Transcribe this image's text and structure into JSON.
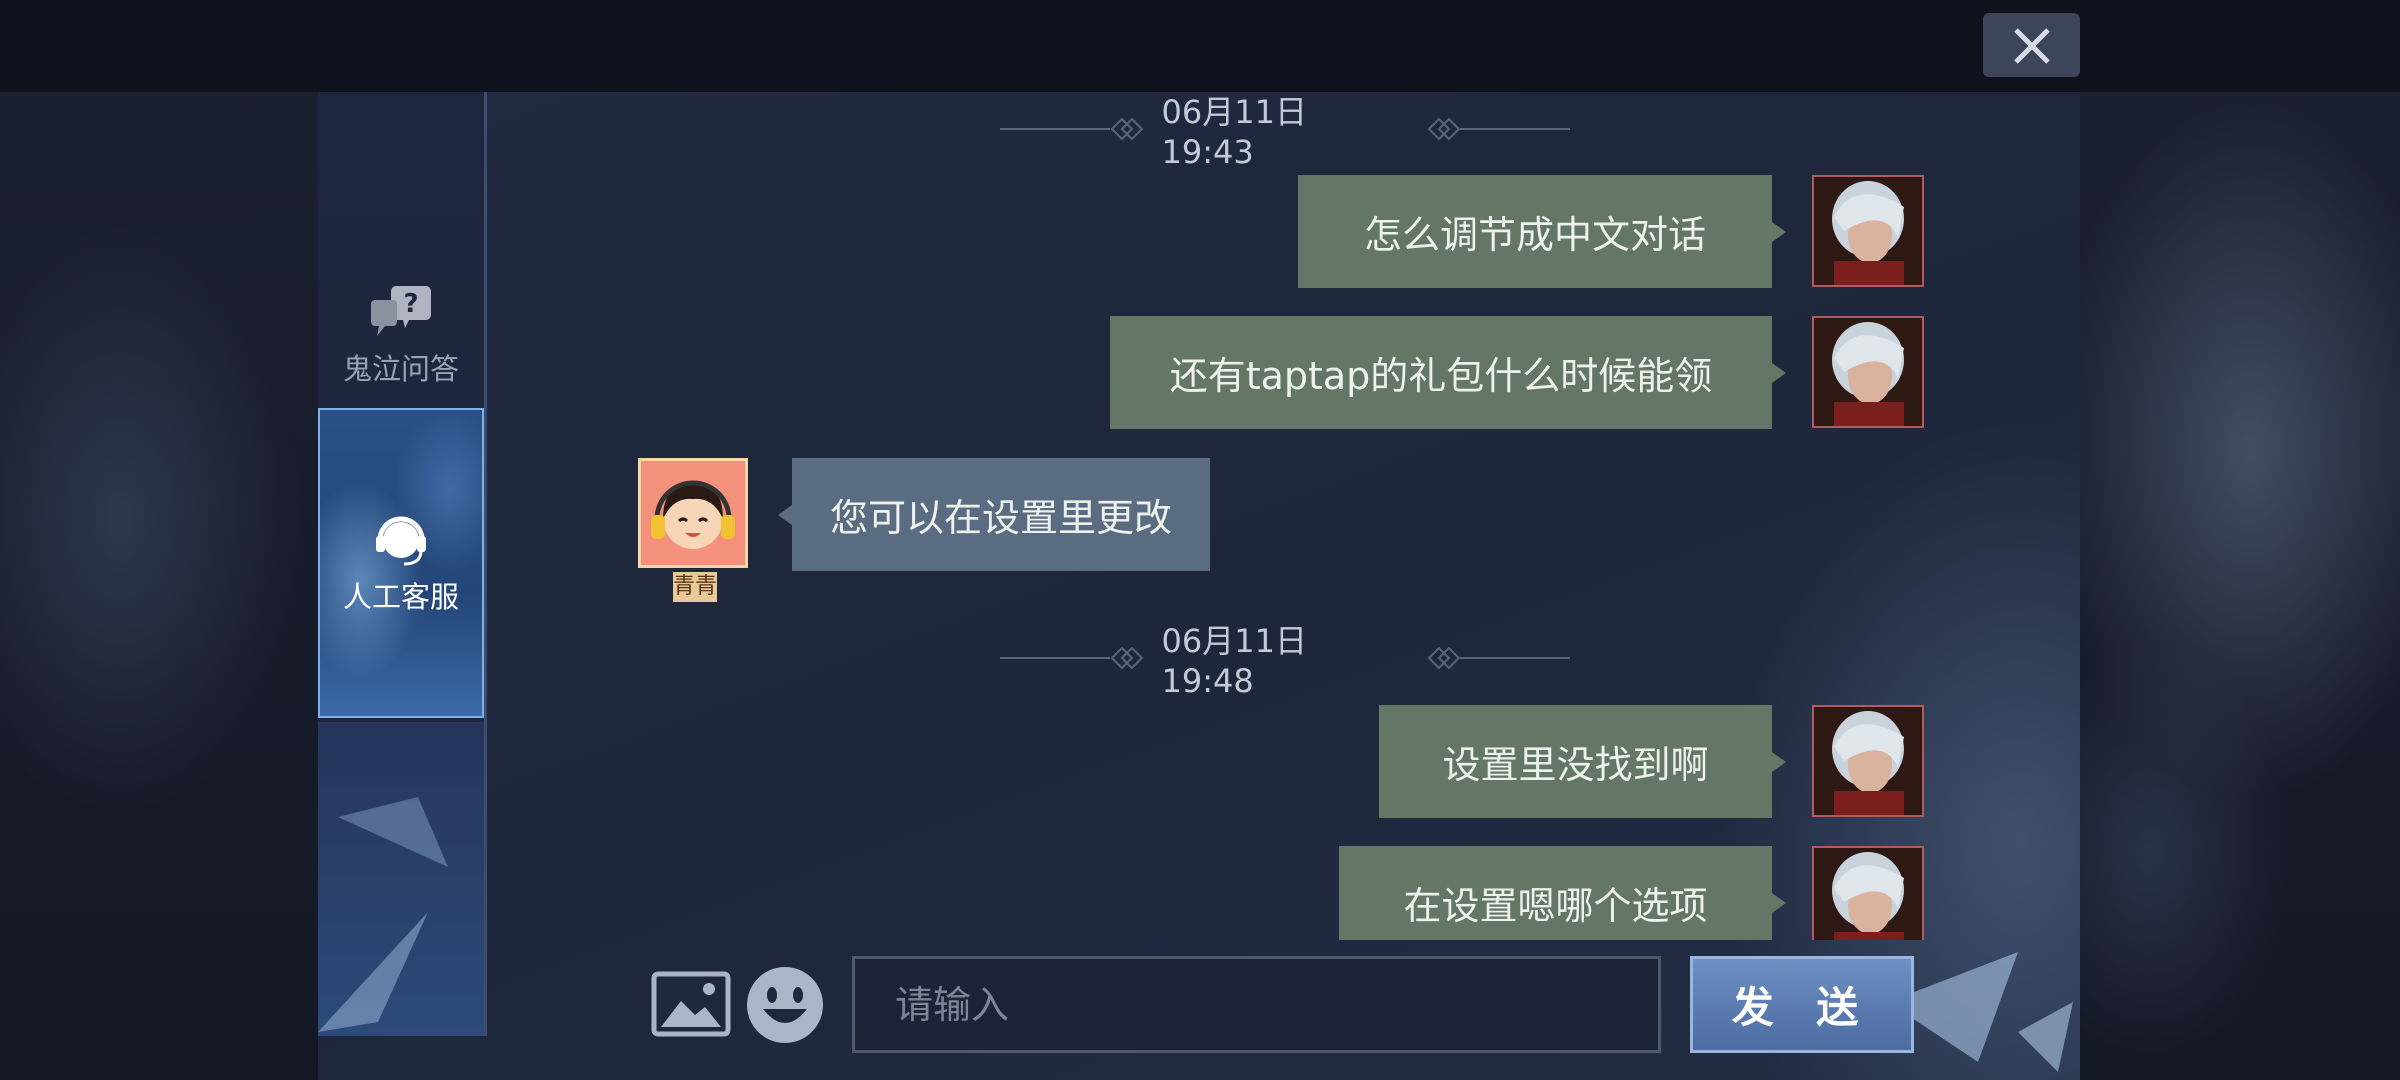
{
  "header": {
    "close_icon": "close-icon"
  },
  "nav": {
    "items": [
      {
        "label": "鬼泣问答",
        "icon": "question-chat-icon",
        "active": false
      },
      {
        "label": "人工客服",
        "icon": "headset-icon",
        "active": true
      }
    ]
  },
  "chat": {
    "timestamps": [
      "06月11日 19:43",
      "06月11日 19:48"
    ],
    "messages": [
      {
        "side": "out",
        "text": "怎么调节成中文对话"
      },
      {
        "side": "out",
        "text": "还有taptap的礼包什么时候能领"
      },
      {
        "side": "in",
        "text": "您可以在设置里更改",
        "sender": "青青"
      },
      {
        "side": "out",
        "text": "设置里没找到啊"
      },
      {
        "side": "out",
        "text": "在设置嗯哪个选项"
      }
    ]
  },
  "composer": {
    "placeholder": "请输入",
    "send_label": "发 送",
    "image_icon": "image-icon",
    "emoji_icon": "emoji-icon"
  },
  "colors": {
    "outgoing_bubble": "#647665",
    "incoming_bubble": "#5a6c81",
    "send_button": "#5a7bb2",
    "active_nav": "#2a4f86"
  }
}
